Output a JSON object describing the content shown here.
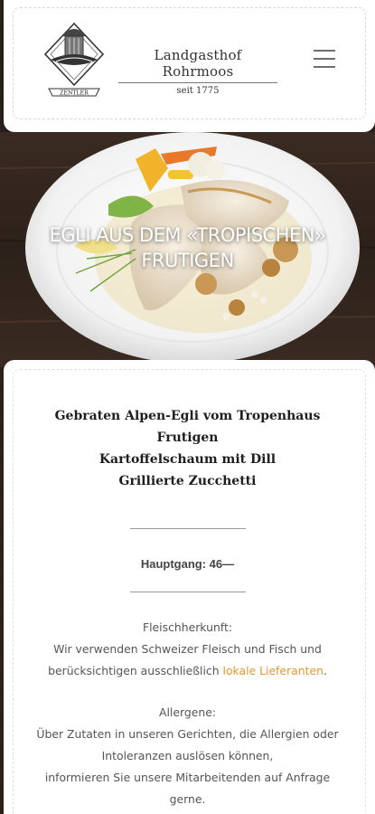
{
  "header": {
    "brand_name": "Landgasthof Rohrmoos",
    "since": "seit 1775",
    "logo_text": "ZENTLER",
    "menu_label": "Menü"
  },
  "hero": {
    "title_line1": "Egli aus dem «Tropischen»",
    "title_line2": "Frutigen"
  },
  "dish": {
    "line1": "Gebraten Alpen-Egli vom Tropenhaus",
    "line2": "Frutigen",
    "line3": "Kartoffelschaum mit Dill",
    "line4": "Grillierte Zucchetti"
  },
  "price": "Hauptgang: 46—",
  "meat_origin": {
    "heading": "Fleischherkunft:",
    "line1": "Wir verwenden Schweizer Fleisch und Fisch und",
    "line2_prefix": "berücksichtigen ausschließlich ",
    "link": "lokale Lieferanten",
    "line2_suffix": "."
  },
  "allergens": {
    "heading": "Allergene:",
    "line1": "Über Zutaten in unseren Gerichten, die Allergien oder",
    "line2": "Intoleranzen auslösen können,",
    "line3": "informieren Sie unsere Mitarbeitenden auf Anfrage",
    "line4": "gerne."
  },
  "colors": {
    "link": "#e8962e",
    "text": "#555555",
    "heading": "#1e1e1e",
    "background": "#2a211b"
  }
}
